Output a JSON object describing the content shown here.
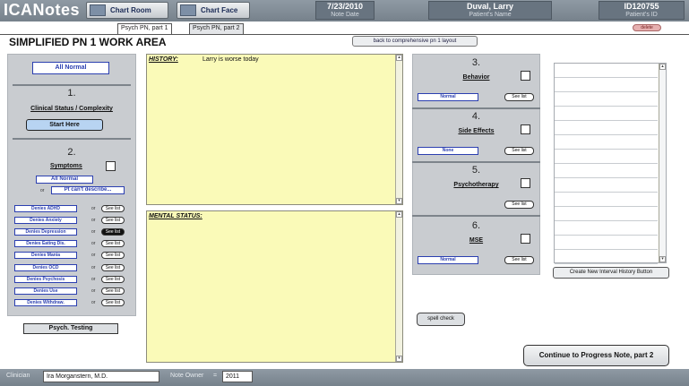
{
  "app": {
    "logo": "ICANotes"
  },
  "top_buttons": {
    "chart_room": "Chart Room",
    "chart_face": "Chart Face"
  },
  "note_date": {
    "value": "7/23/2010",
    "label": "Note Date"
  },
  "patient_name": {
    "value": "Duval, Larry",
    "label": "Patient's Name"
  },
  "patient_id": {
    "value": "ID120755",
    "label": "Patient's ID"
  },
  "delete_label": "delete",
  "tabs": [
    {
      "label": "Psych PN, part 1"
    },
    {
      "label": "Psych PN, part 2"
    }
  ],
  "work_area_title": "SIMPLIFIED PN 1 WORK AREA",
  "back_button": "back to comprehensive pn 1 layout",
  "left_panel": {
    "all_normal": "All Normal",
    "section1_number": "1.",
    "section1_label": "Clinical Status / Complexity",
    "start_here": "Start Here",
    "section2_number": "2.",
    "section2_label": "Symptoms",
    "symptoms_all_normal": "All Normal",
    "or": "or",
    "pt_cant_describe": "Pt can't describe...",
    "see_list": "See list",
    "symptoms": [
      "Denies ADHD",
      "Denies Anxiety",
      "Denies Depression",
      "Denies Eating Dis.",
      "Denies Mania",
      "Denies OCD",
      "Denies Psychosis",
      "Denies Use",
      "Denies Withdraw."
    ]
  },
  "psych_testing": "Psych. Testing",
  "history": {
    "label": "HISTORY:",
    "text": "Larry is worse today"
  },
  "mental_status": {
    "label": "MENTAL STATUS:",
    "text": ""
  },
  "right_panel": {
    "sections": [
      {
        "number": "3.",
        "label": "Behavior",
        "value": "Normal",
        "see_list": "See list"
      },
      {
        "number": "4.",
        "label": "Side Effects",
        "value": "None",
        "see_list": "See list"
      },
      {
        "number": "5.",
        "label": "Psychotherapy",
        "value": "",
        "see_list": "See list"
      },
      {
        "number": "6.",
        "label": "MSE",
        "value": "Normal",
        "see_list": "See list"
      }
    ]
  },
  "spell_check": "spell check",
  "create_button": "Create New Interval History Button",
  "continue_button": "Continue to Progress Note, part 2",
  "bottom": {
    "clinician_label": "Clinician",
    "clinician_value": "Ira Morganstern, M.D.",
    "note_owner_label": "Note Owner",
    "note_owner_value": "2011"
  }
}
